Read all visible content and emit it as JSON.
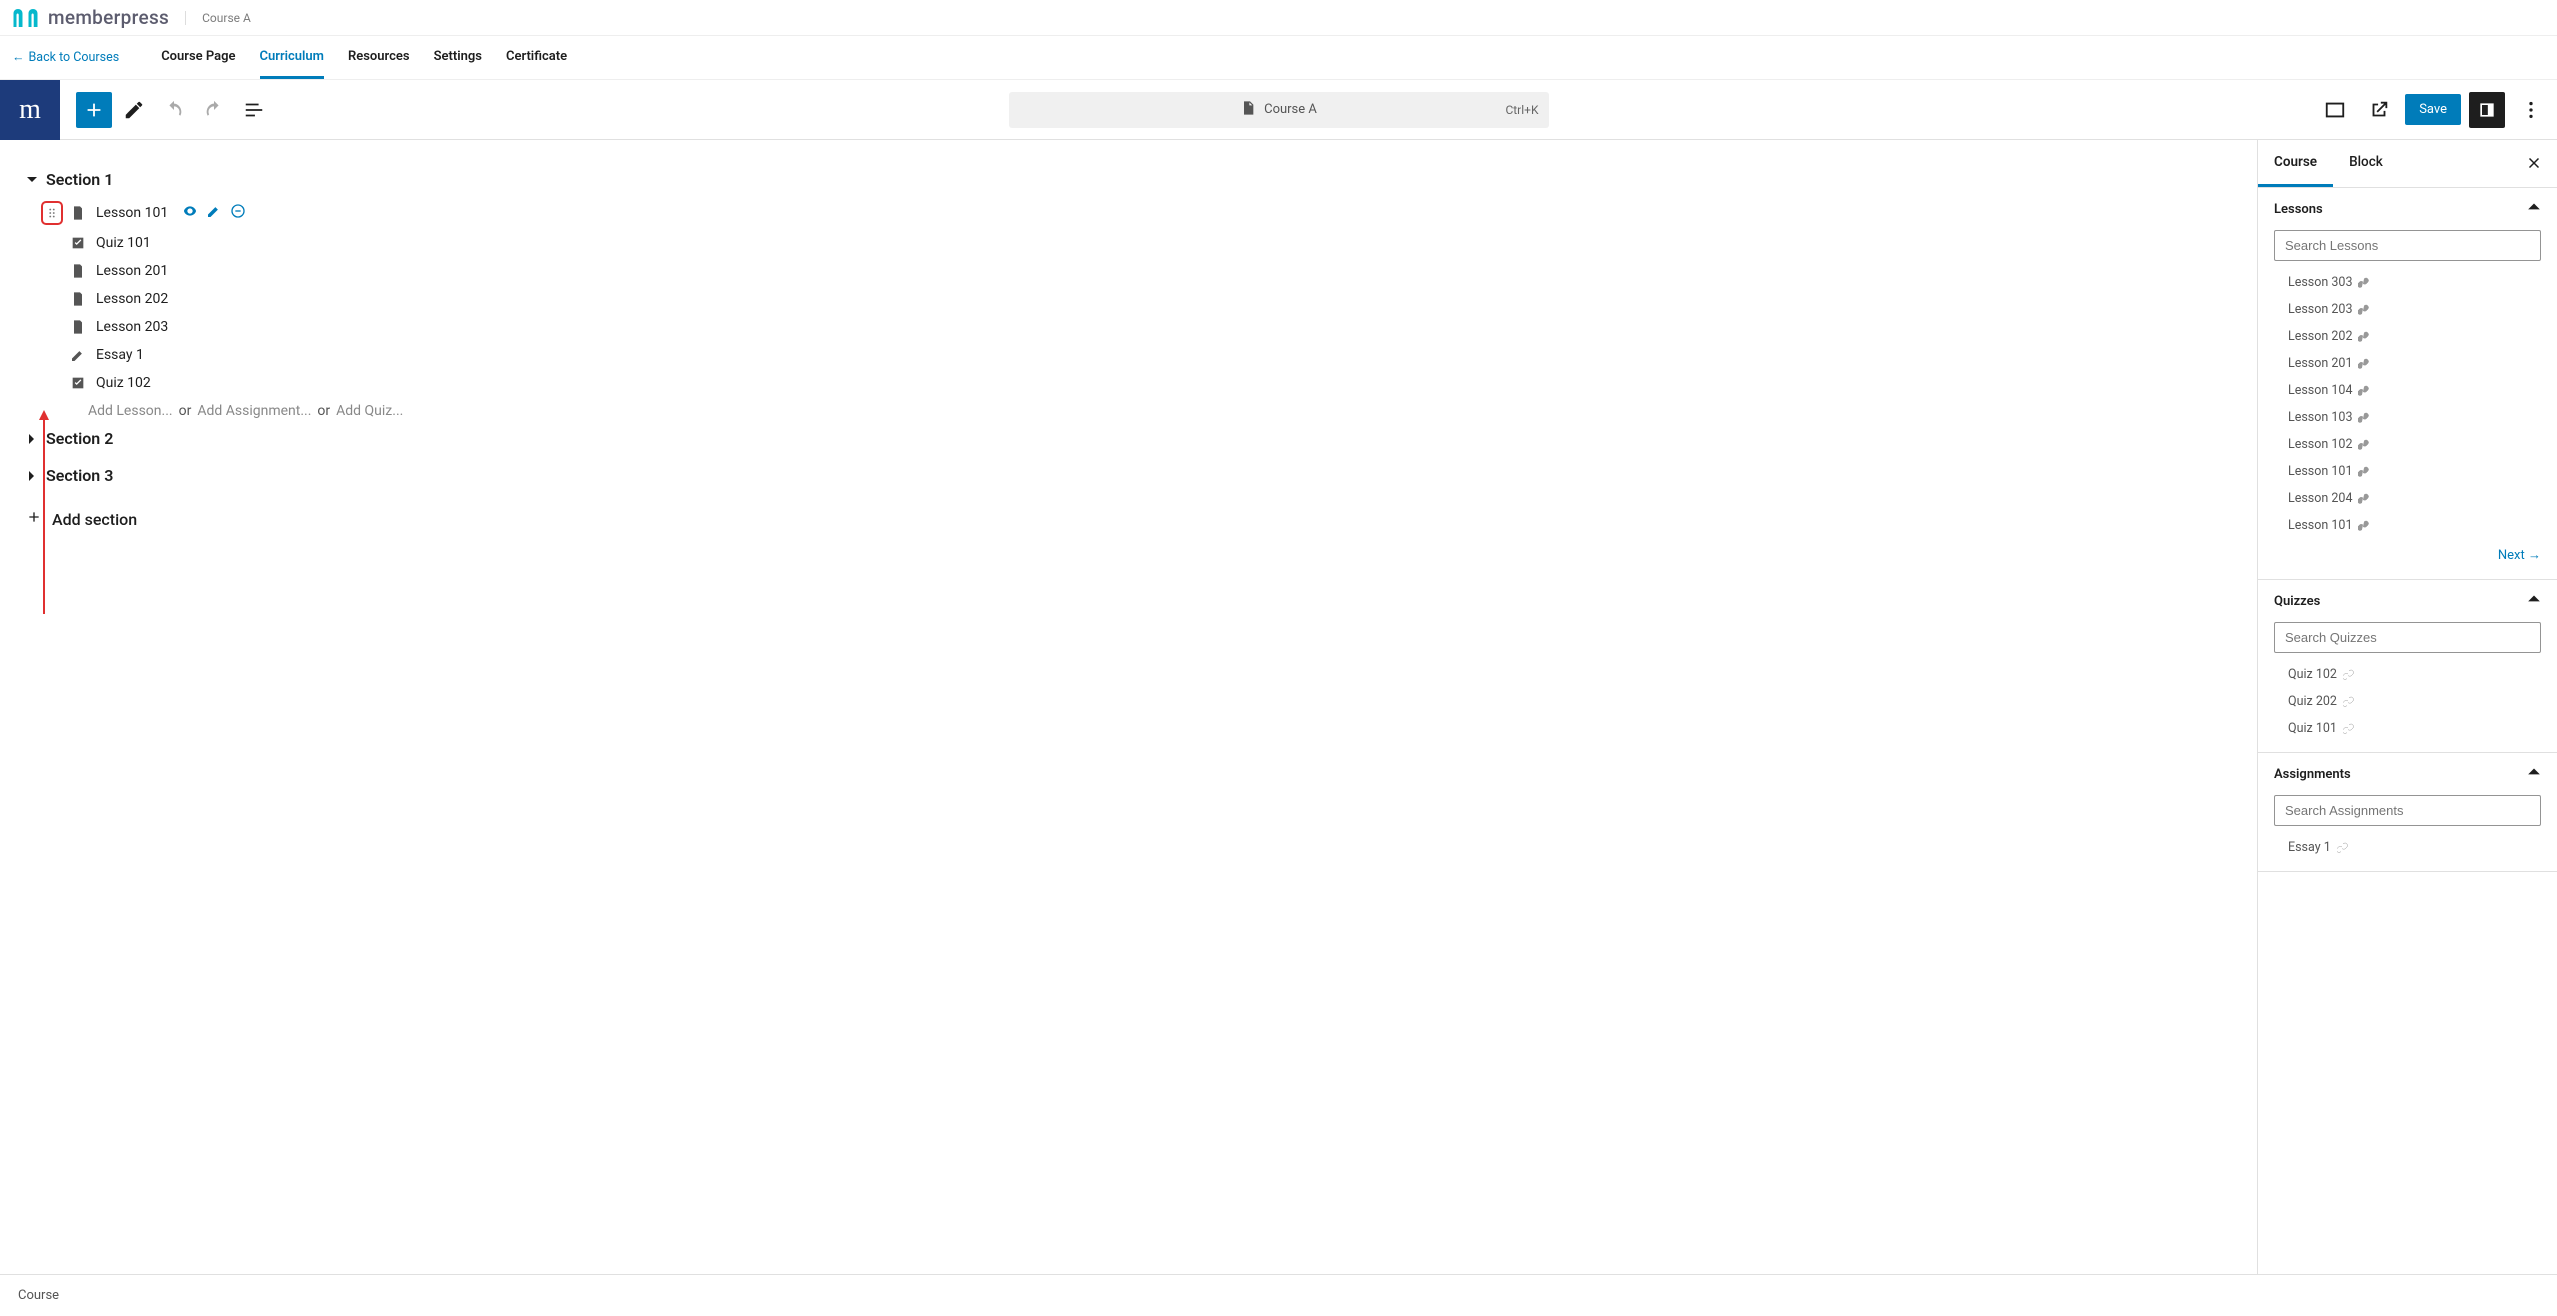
{
  "brand": {
    "logo_text": "memberpress",
    "course_name": "Course A"
  },
  "back_link": "Back to Courses",
  "top_tabs": [
    "Course Page",
    "Curriculum",
    "Resources",
    "Settings",
    "Certificate"
  ],
  "top_tab_active_index": 1,
  "doc_bar": {
    "title": "Course A",
    "shortcut": "Ctrl+K"
  },
  "save_label": "Save",
  "sections": [
    {
      "title": "Section 1",
      "expanded": true,
      "items": [
        {
          "type": "lesson",
          "label": "Lesson 101",
          "selected": true
        },
        {
          "type": "quiz",
          "label": "Quiz 101"
        },
        {
          "type": "lesson",
          "label": "Lesson 201"
        },
        {
          "type": "lesson",
          "label": "Lesson 202"
        },
        {
          "type": "lesson",
          "label": "Lesson 203"
        },
        {
          "type": "essay",
          "label": "Essay 1"
        },
        {
          "type": "quiz",
          "label": "Quiz 102"
        }
      ],
      "add_links": {
        "lesson": "Add Lesson...",
        "or1": "or",
        "assignment": "Add Assignment...",
        "or2": "or",
        "quiz": "Add Quiz..."
      }
    },
    {
      "title": "Section 2",
      "expanded": false
    },
    {
      "title": "Section 3",
      "expanded": false
    }
  ],
  "add_section_label": "Add section",
  "sidebar": {
    "tabs": [
      "Course",
      "Block"
    ],
    "active_tab_index": 0,
    "panels": {
      "lessons": {
        "title": "Lessons",
        "search_placeholder": "Search Lessons",
        "items": [
          "Lesson 303",
          "Lesson 203",
          "Lesson 202",
          "Lesson 201",
          "Lesson 104",
          "Lesson 103",
          "Lesson 102",
          "Lesson 101",
          "Lesson 204",
          "Lesson 101"
        ],
        "next_label": "Next"
      },
      "quizzes": {
        "title": "Quizzes",
        "search_placeholder": "Search Quizzes",
        "items": [
          "Quiz 102",
          "Quiz 202",
          "Quiz 101"
        ]
      },
      "assignments": {
        "title": "Assignments",
        "search_placeholder": "Search Assignments",
        "items": [
          "Essay 1"
        ]
      }
    }
  },
  "footer": {
    "breadcrumb": "Course"
  }
}
